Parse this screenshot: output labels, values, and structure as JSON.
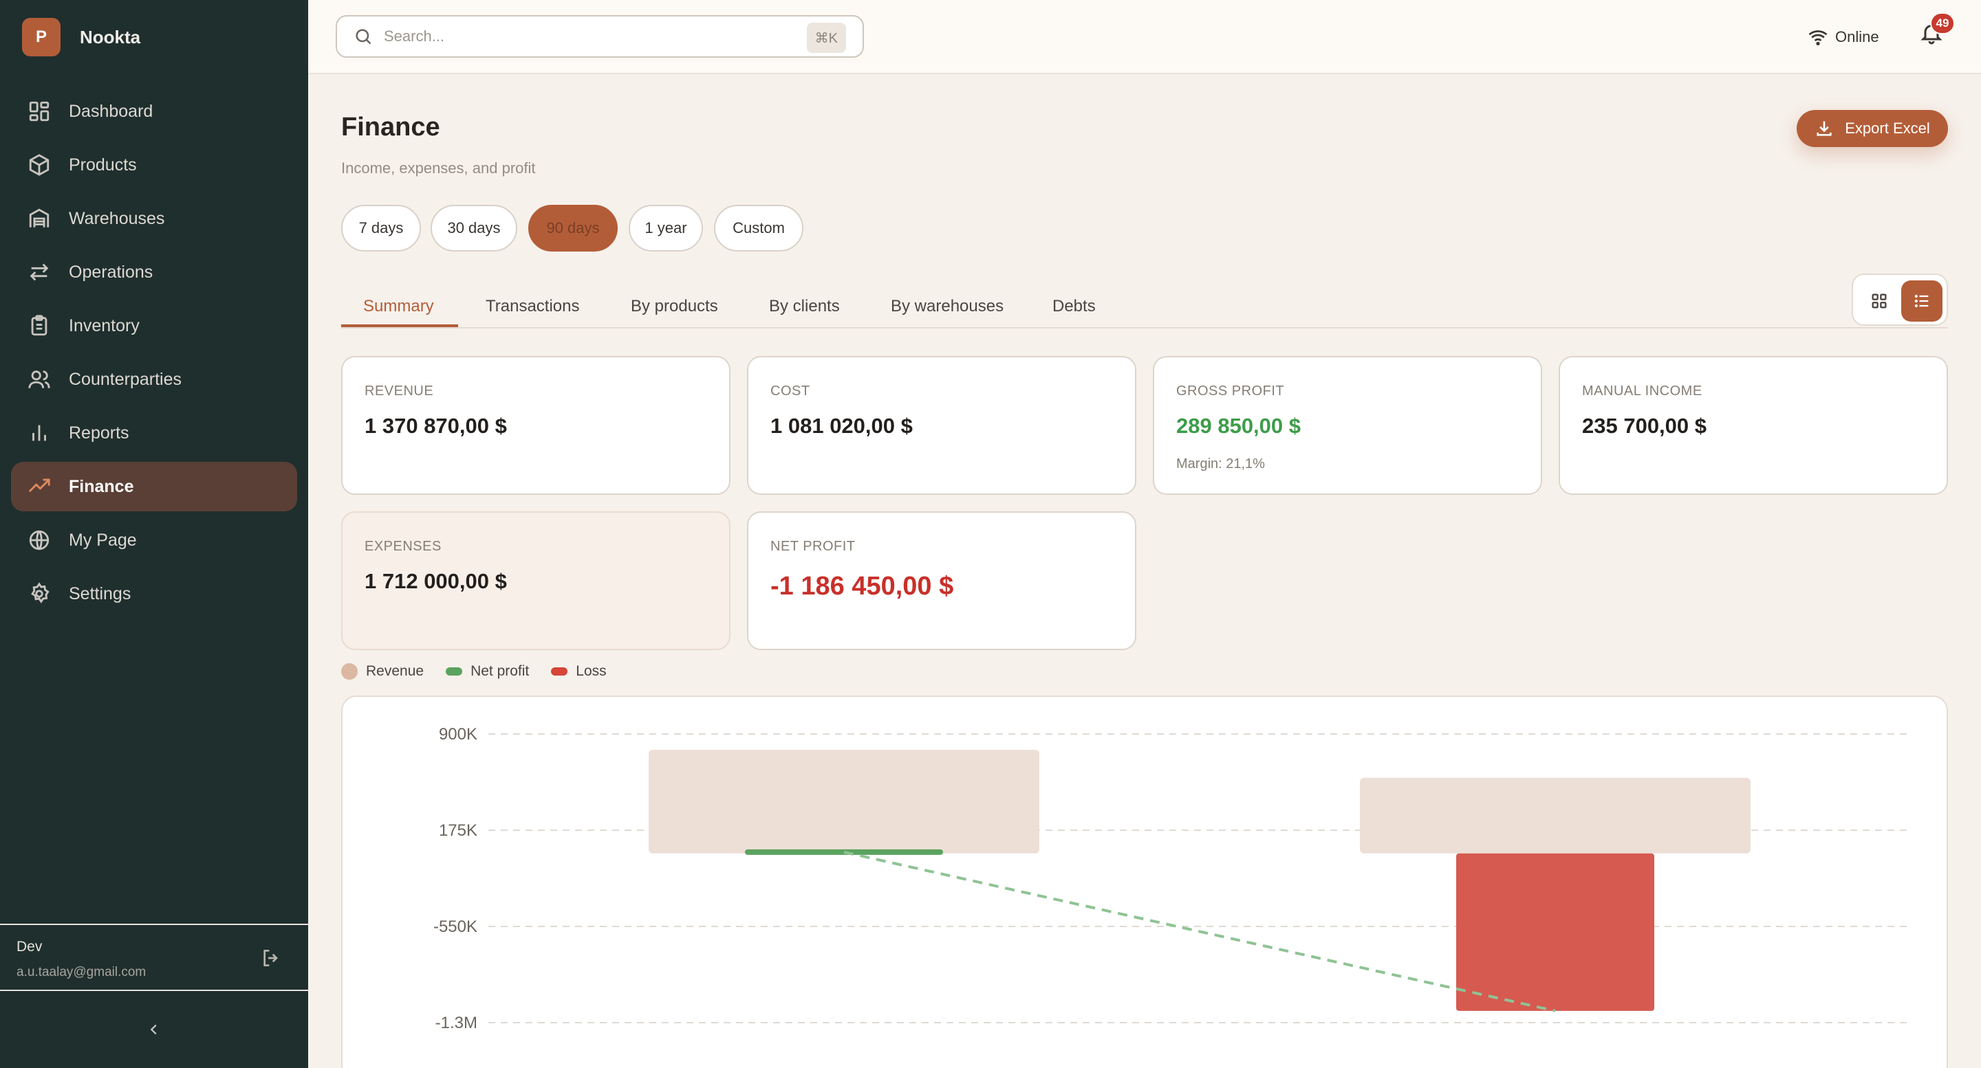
{
  "brand": {
    "initial": "P",
    "name": "Nookta"
  },
  "sidebar": {
    "items": [
      {
        "label": "Dashboard",
        "icon": "dashboard-icon"
      },
      {
        "label": "Products",
        "icon": "box-icon"
      },
      {
        "label": "Warehouses",
        "icon": "warehouse-icon"
      },
      {
        "label": "Operations",
        "icon": "arrows-icon"
      },
      {
        "label": "Inventory",
        "icon": "clipboard-icon"
      },
      {
        "label": "Counterparties",
        "icon": "users-icon"
      },
      {
        "label": "Reports",
        "icon": "bar-chart-icon"
      },
      {
        "label": "Finance",
        "icon": "trending-up-icon"
      },
      {
        "label": "My Page",
        "icon": "globe-icon"
      },
      {
        "label": "Settings",
        "icon": "gear-icon"
      }
    ],
    "active": "Finance",
    "user": {
      "name": "Dev",
      "email": "a.u.taalay@gmail.com"
    }
  },
  "topbar": {
    "search_placeholder": "Search...",
    "shortcut": "⌘K",
    "status": "Online",
    "notifications": "49"
  },
  "page": {
    "title": "Finance",
    "subtitle": "Income, expenses, and profit",
    "export_label": "Export Excel",
    "periods": [
      "7 days",
      "30 days",
      "90 days",
      "1 year",
      "Custom"
    ],
    "active_period": "90 days",
    "tabs": [
      "Summary",
      "Transactions",
      "By products",
      "By clients",
      "By warehouses",
      "Debts"
    ],
    "active_tab": "Summary"
  },
  "cards": {
    "revenue": {
      "label": "REVENUE",
      "value": "1 370 870,00 $"
    },
    "cost": {
      "label": "COST",
      "value": "1 081 020,00 $"
    },
    "gross_profit": {
      "label": "GROSS PROFIT",
      "value": "289 850,00 $",
      "sub": "Margin: 21,1%"
    },
    "manual_income": {
      "label": "MANUAL INCOME",
      "value": "235 700,00 $"
    },
    "expenses": {
      "label": "EXPENSES",
      "value": "1 712 000,00 $"
    },
    "net_profit": {
      "label": "NET PROFIT",
      "value": "-1 186 450,00 $"
    }
  },
  "colors": {
    "accent": "#b35d38",
    "revenue": "#eddfd6",
    "net_profit": "#5aa35f",
    "loss": "#d65a50"
  },
  "legend": {
    "revenue": "Revenue",
    "net_profit": "Net profit",
    "loss": "Loss"
  },
  "chart_data": {
    "type": "bar",
    "y_ticks": [
      {
        "value": 900000,
        "label": "900K"
      },
      {
        "value": 175000,
        "label": "175K"
      },
      {
        "value": -550000,
        "label": "-550K"
      },
      {
        "value": -1275000,
        "label": "-1.3M"
      }
    ],
    "ylim": [
      -1300000,
      1000000
    ],
    "grid": true,
    "legend_position": "top-left",
    "series": [
      {
        "name": "Revenue",
        "values": [
          780000,
          570000
        ]
      },
      {
        "name": "Net profit",
        "values": [
          10000,
          null
        ]
      },
      {
        "name": "Loss",
        "values": [
          null,
          -1186450
        ]
      }
    ],
    "net_profit_trend": [
      10000,
      -1186450
    ]
  }
}
